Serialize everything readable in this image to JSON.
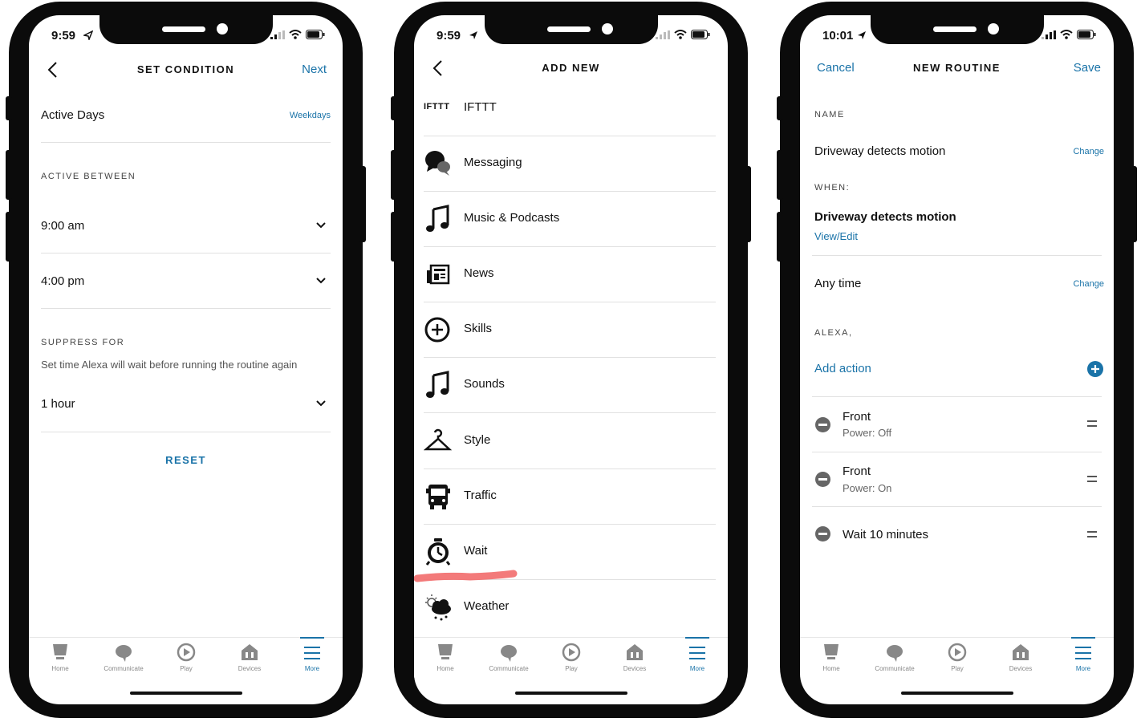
{
  "colors": {
    "accent": "#1a73a8",
    "phone_frame": "#0b0b0b",
    "highlight": "#f26b6b"
  },
  "tabbar": [
    "Home",
    "Communicate",
    "Play",
    "Devices",
    "More"
  ],
  "phone1": {
    "time": "9:59",
    "title": "SET CONDITION",
    "next": "Next",
    "active_days_label": "Active Days",
    "active_days_value": "Weekdays",
    "active_between_header": "ACTIVE BETWEEN",
    "start_time": "9:00 am",
    "end_time": "4:00 pm",
    "suppress_header": "SUPPRESS FOR",
    "suppress_desc": "Set time Alexa will wait before running the routine again",
    "suppress_value": "1 hour",
    "reset": "RESET"
  },
  "phone2": {
    "time": "9:59",
    "title": "ADD NEW",
    "ifttt_logo": "IFTTT",
    "items": [
      {
        "label": "IFTTT",
        "icon": "ifttt-icon"
      },
      {
        "label": "Messaging",
        "icon": "chat-bubbles-icon"
      },
      {
        "label": "Music & Podcasts",
        "icon": "music-note-icon"
      },
      {
        "label": "News",
        "icon": "newspaper-icon"
      },
      {
        "label": "Skills",
        "icon": "skills-plus-icon"
      },
      {
        "label": "Sounds",
        "icon": "music-note-icon"
      },
      {
        "label": "Style",
        "icon": "hanger-icon"
      },
      {
        "label": "Traffic",
        "icon": "bus-icon"
      },
      {
        "label": "Wait",
        "icon": "alarm-clock-icon"
      },
      {
        "label": "Weather",
        "icon": "weather-cloud-icon"
      }
    ]
  },
  "phone3": {
    "time": "10:01",
    "title": "NEW ROUTINE",
    "cancel": "Cancel",
    "save": "Save",
    "name_header": "NAME",
    "name_value": "Driveway detects motion",
    "change": "Change",
    "when_header": "WHEN:",
    "when_value": "Driveway detects motion",
    "view_edit": "View/Edit",
    "any_time": "Any time",
    "alexa_header": "ALEXA,",
    "add_action": "Add action",
    "actions": [
      {
        "title": "Front",
        "subtitle": "Power: Off"
      },
      {
        "title": "Front",
        "subtitle": "Power: On"
      },
      {
        "title": "Wait 10 minutes",
        "subtitle": ""
      }
    ]
  }
}
